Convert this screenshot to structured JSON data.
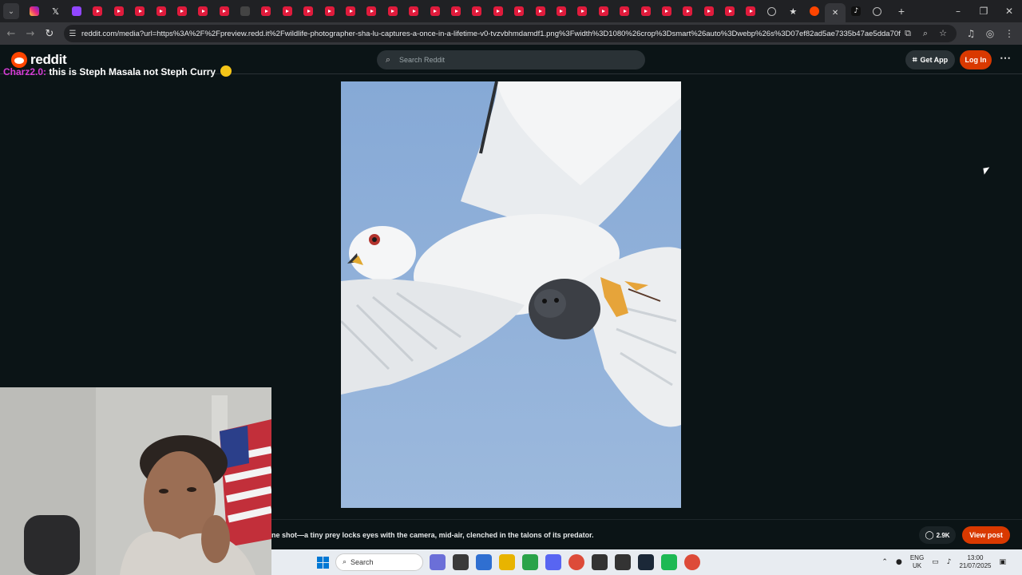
{
  "browser": {
    "tab_favicons": [
      "ig",
      "x",
      "tw",
      "yt",
      "yt",
      "yt",
      "yt",
      "yt",
      "yt",
      "yt",
      "doc",
      "yt",
      "yt",
      "yt",
      "yt",
      "yt",
      "yt",
      "yt",
      "yt",
      "yt",
      "yt",
      "yt",
      "yt",
      "yt",
      "yt",
      "yt",
      "yt",
      "yt",
      "yt",
      "yt",
      "yt",
      "yt",
      "yt",
      "yt",
      "yt",
      "gen",
      "star",
      "rd",
      "close",
      "tt",
      "gen"
    ],
    "url": "reddit.com/media?url=https%3A%2F%2Fpreview.redd.it%2Fwildlife-photographer-sha-lu-captures-a-once-in-a-lifetime-v0-tvzvbhmdamdf1.png%3Fwidth%3D1080%26crop%3Dsmart%26auto%3Dwebp%26s%3D07ef82ad5ae7335b47ae5dda70f04..."
  },
  "reddit": {
    "logo_text": "reddit",
    "search_placeholder": "Search Reddit",
    "get_app_label": "Get App",
    "login_label": "Log In",
    "comments_count": "2.9K",
    "view_post_label": "View post",
    "caption": "ne shot—a tiny prey locks eyes with the camera, mid-air, clenched in the talons of its predator."
  },
  "chat_overlay": {
    "user": "Charz2.0:",
    "message": "this is Steph Masala not Steph Curry"
  },
  "taskbar": {
    "search_label": "Search",
    "lang_line1": "ENG",
    "lang_line2": "UK",
    "time": "13:00",
    "date": "21/07/2025",
    "app_colors": [
      "#6b6fd8",
      "#3a3a3a",
      "#2f6fd1",
      "#e8b400",
      "#2aa34a",
      "#5865f2",
      "#dd4b39",
      "#333333",
      "#333333",
      "#1b2838",
      "#1db954",
      "#dd4b39"
    ]
  },
  "colors": {
    "reddit_orange": "#ff4500",
    "login_bg": "#d93900",
    "page_bg": "#0b1416",
    "sky": "#8fb0d8"
  }
}
